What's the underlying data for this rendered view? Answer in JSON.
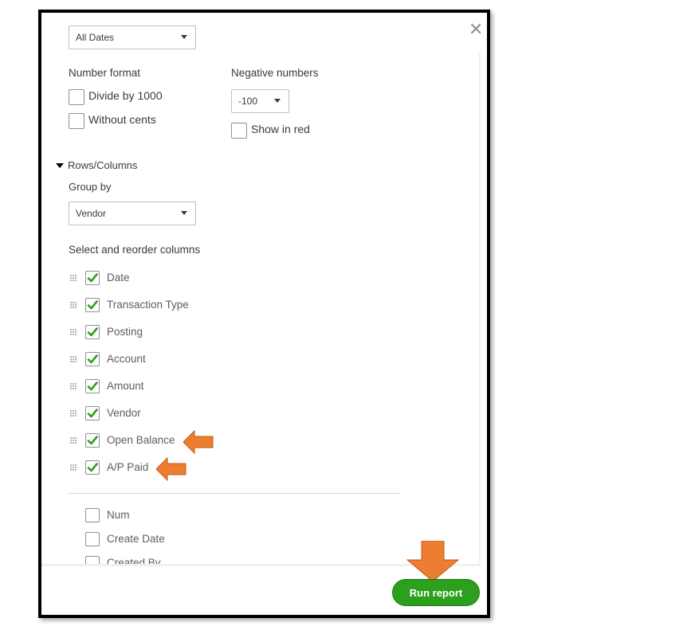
{
  "dates_select": {
    "value": "All Dates"
  },
  "number_format": {
    "heading": "Number format",
    "options": [
      {
        "label": "Divide by 1000",
        "checked": false
      },
      {
        "label": "Without cents",
        "checked": false
      }
    ]
  },
  "negative_numbers": {
    "heading": "Negative numbers",
    "select_value": "-100",
    "show_in_red": {
      "label": "Show in red",
      "checked": false
    }
  },
  "rows_columns": {
    "toggle_label": "Rows/Columns",
    "expanded": true,
    "group_by_label": "Group by",
    "group_by_value": "Vendor"
  },
  "columns": {
    "heading": "Select and reorder columns",
    "selected": [
      {
        "label": "Date",
        "checked": true
      },
      {
        "label": "Transaction Type",
        "checked": true
      },
      {
        "label": "Posting",
        "checked": true
      },
      {
        "label": "Account",
        "checked": true
      },
      {
        "label": "Amount",
        "checked": true
      },
      {
        "label": "Vendor",
        "checked": true
      },
      {
        "label": "Open Balance",
        "checked": true,
        "highlighted": true
      },
      {
        "label": "A/P Paid",
        "checked": true,
        "highlighted": true
      }
    ],
    "unselected": [
      {
        "label": "Num",
        "checked": false
      },
      {
        "label": "Create Date",
        "checked": false
      },
      {
        "label": "Created By",
        "checked": false
      }
    ]
  },
  "footer": {
    "run_report_label": "Run report"
  },
  "colors": {
    "accent_green": "#2ca01c",
    "annotation_arrow": "#ed7d31",
    "checkmark": "#2ca01c"
  },
  "icons": {
    "close": "close-icon",
    "caret": "caret-down-icon",
    "grip": "drag-handle-icon",
    "check": "checkmark-icon",
    "annotation": "arrow-annotation-icon"
  }
}
